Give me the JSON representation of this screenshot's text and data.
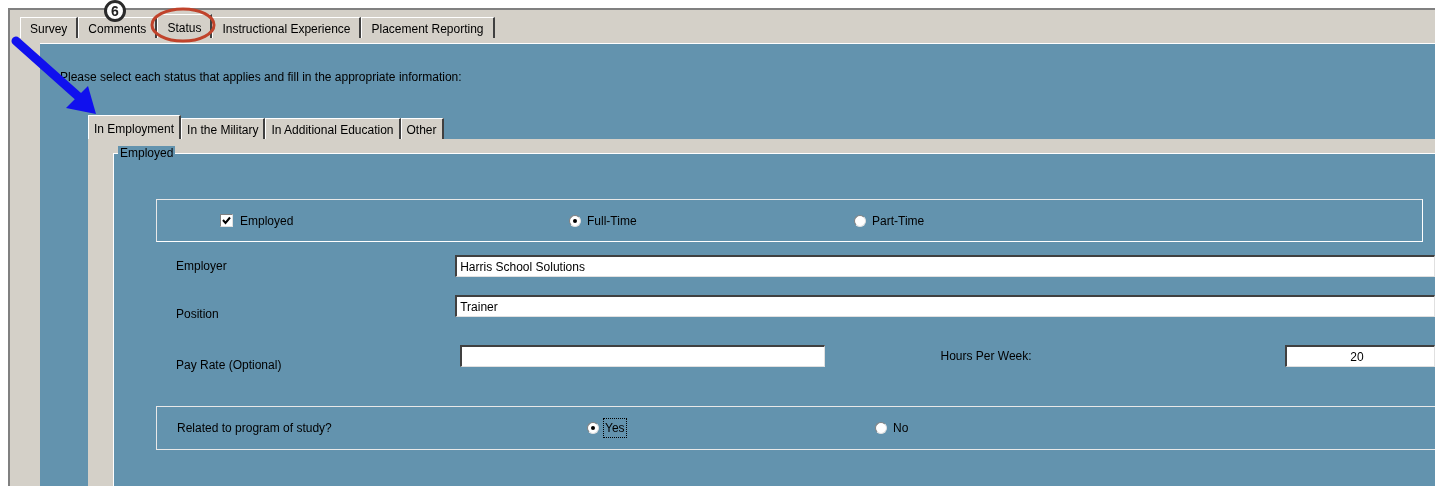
{
  "main_tabs": [
    {
      "label": "Survey",
      "selected": false
    },
    {
      "label": "Comments",
      "selected": false
    },
    {
      "label": "Status",
      "selected": true
    },
    {
      "label": "Instructional Experience",
      "selected": false
    },
    {
      "label": "Placement Reporting",
      "selected": false
    }
  ],
  "step_badge": "6",
  "instructions": "Please select each status that applies and fill in the appropriate information:",
  "sub_tabs": [
    {
      "label": "In Employment",
      "selected": true
    },
    {
      "label": "In the Military",
      "selected": false
    },
    {
      "label": "In Additional Education",
      "selected": false
    },
    {
      "label": "Other",
      "selected": false
    }
  ],
  "group": {
    "title": "Employed",
    "employed_checkbox": {
      "label": "Employed",
      "checked": true
    },
    "employment_type": [
      {
        "label": "Full-Time",
        "selected": true
      },
      {
        "label": "Part-Time",
        "selected": false
      }
    ],
    "employer": {
      "label": "Employer",
      "value": "Harris School Solutions"
    },
    "position": {
      "label": "Position",
      "value": "Trainer"
    },
    "pay_rate": {
      "label": "Pay Rate (Optional)"
    },
    "hours_per_week": {
      "label": "Hours Per Week:",
      "value": "20"
    },
    "related": {
      "label": "Related to program of study?",
      "options": [
        {
          "label": "Yes",
          "selected": true,
          "focused": true
        },
        {
          "label": "No",
          "selected": false,
          "focused": false
        }
      ]
    }
  }
}
